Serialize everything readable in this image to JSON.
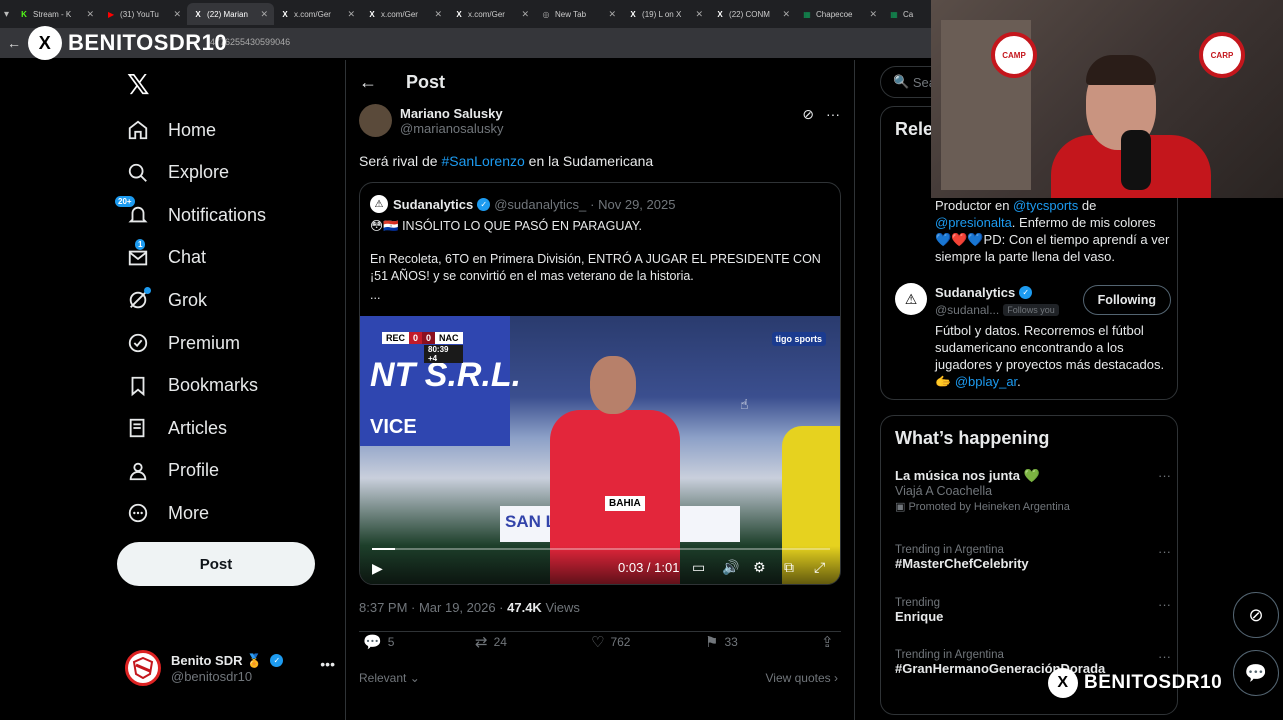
{
  "browser": {
    "tabs": [
      {
        "title": "Stream - K",
        "icon": "kick-icon",
        "color": "#53fc18"
      },
      {
        "title": "(31) YouTu",
        "icon": "youtube-icon",
        "color": "#ff0000"
      },
      {
        "title": "(22) Marian",
        "icon": "x-icon",
        "color": "#ffffff",
        "active": true
      },
      {
        "title": "x.com/Ger",
        "icon": "x-icon",
        "color": "#ffffff"
      },
      {
        "title": "x.com/Ger",
        "icon": "x-icon",
        "color": "#ffffff"
      },
      {
        "title": "x.com/Ger",
        "icon": "x-icon",
        "color": "#ffffff"
      },
      {
        "title": "New Tab",
        "icon": "globe-icon",
        "color": "#aaaaaa"
      },
      {
        "title": "(19) L on X",
        "icon": "x-icon",
        "color": "#ffffff"
      },
      {
        "title": "(22) CONM",
        "icon": "x-icon",
        "color": "#ffffff"
      },
      {
        "title": "Chapecoe",
        "icon": "sheets-icon",
        "color": "#0f9d58"
      },
      {
        "title": "Ca",
        "icon": "sheets-icon",
        "color": "#0f9d58"
      }
    ],
    "url_fragment": "4776255430599046"
  },
  "watermark": {
    "top_left": "BENITOSDR10",
    "bottom_right": "BENITOSDR10"
  },
  "nav": {
    "items": [
      {
        "label": "Home",
        "icon": "home-icon"
      },
      {
        "label": "Explore",
        "icon": "search-icon"
      },
      {
        "label": "Notifications",
        "icon": "bell-icon",
        "badge": "20+"
      },
      {
        "label": "Chat",
        "icon": "mail-icon",
        "badge": "1"
      },
      {
        "label": "Grok",
        "icon": "grok-icon",
        "dot": true
      },
      {
        "label": "Premium",
        "icon": "premium-icon"
      },
      {
        "label": "Bookmarks",
        "icon": "bookmark-icon"
      },
      {
        "label": "Articles",
        "icon": "articles-icon"
      },
      {
        "label": "Profile",
        "icon": "person-icon"
      },
      {
        "label": "More",
        "icon": "more-circle-icon"
      }
    ],
    "post_button": "Post",
    "account": {
      "name": "Benito SDR 🏅",
      "handle": "@benitosdr10"
    }
  },
  "main": {
    "header_title": "Post",
    "author": {
      "name": "Mariano Salusky",
      "handle": "@marianosalusky"
    },
    "text_before": "Será rival de ",
    "hashtag": "#SanLorenzo",
    "text_after": " en la Sudamericana",
    "quote": {
      "name": "Sudanalytics",
      "handle": "@sudanalytics_",
      "date": "· Nov 29, 2025",
      "line1": "😳🇵🇾 INSÓLITO LO QUE PASÓ EN PARAGUAY.",
      "line2": "En Recoleta, 6TO en Primera División, ENTRÓ A JUGAR EL PRESIDENTE CON ¡51 AÑOS! y se convirtió en el mas veterano de la historia.",
      "line3": "..."
    },
    "video": {
      "score_home": "REC",
      "score_home_goals": "0",
      "score_away_goals": "0",
      "score_away": "NAC",
      "clock": "80:39",
      "added": "+4",
      "broadcaster": "tigo sports",
      "time": "0:03 / 1:01",
      "progress": 0.05,
      "ref_badge": "BAHIA",
      "sign_text": "SAN LUCAS"
    },
    "meta": {
      "time": "8:37 PM · Mar 19, 2026 · ",
      "views": "47.4K",
      "views_label": " Views"
    },
    "stats": {
      "replies": "5",
      "reposts": "24",
      "likes": "762",
      "bookmarks": "33"
    },
    "relevant": "Relevant",
    "view_quotes": "View quotes"
  },
  "right": {
    "search_placeholder": "Search",
    "relevant_title": "Rele",
    "bio1": {
      "pre": "Productor en ",
      "link1": "@tycsports",
      "mid": " de ",
      "link2": "@presionalta",
      "post": ". Enfermo de mis colores 💙❤️💙PD: Con el tiempo aprendí a ver siempre la parte llena del vaso."
    },
    "user2": {
      "name": "Sudanalytics",
      "handle": "@sudanal...",
      "follows_you": "Follows you",
      "button": "Following",
      "bio_pre": "Fútbol y datos. Recorremos el fútbol sudamericano encontrando a los jugadores y proyectos más destacados. 🫱 ",
      "bio_link": "@bplay_ar",
      "bio_post": "."
    },
    "happening_title": "What’s happening",
    "trends": [
      {
        "context": "",
        "name": "La música nos junta 💚",
        "sub": "Viajá A Coachella",
        "promo": "Promoted by Heineken Argentina"
      },
      {
        "context": "Trending in Argentina",
        "name": "#MasterChefCelebrity"
      },
      {
        "context": "Trending",
        "name": "Enrique"
      },
      {
        "context": "Trending in Argentina",
        "name": "#GranHermanoGeneraciónDorada"
      }
    ]
  },
  "colors": {
    "accent": "#1d9bf0",
    "background": "#000000",
    "border": "#2f3336",
    "muted": "#71767b"
  }
}
